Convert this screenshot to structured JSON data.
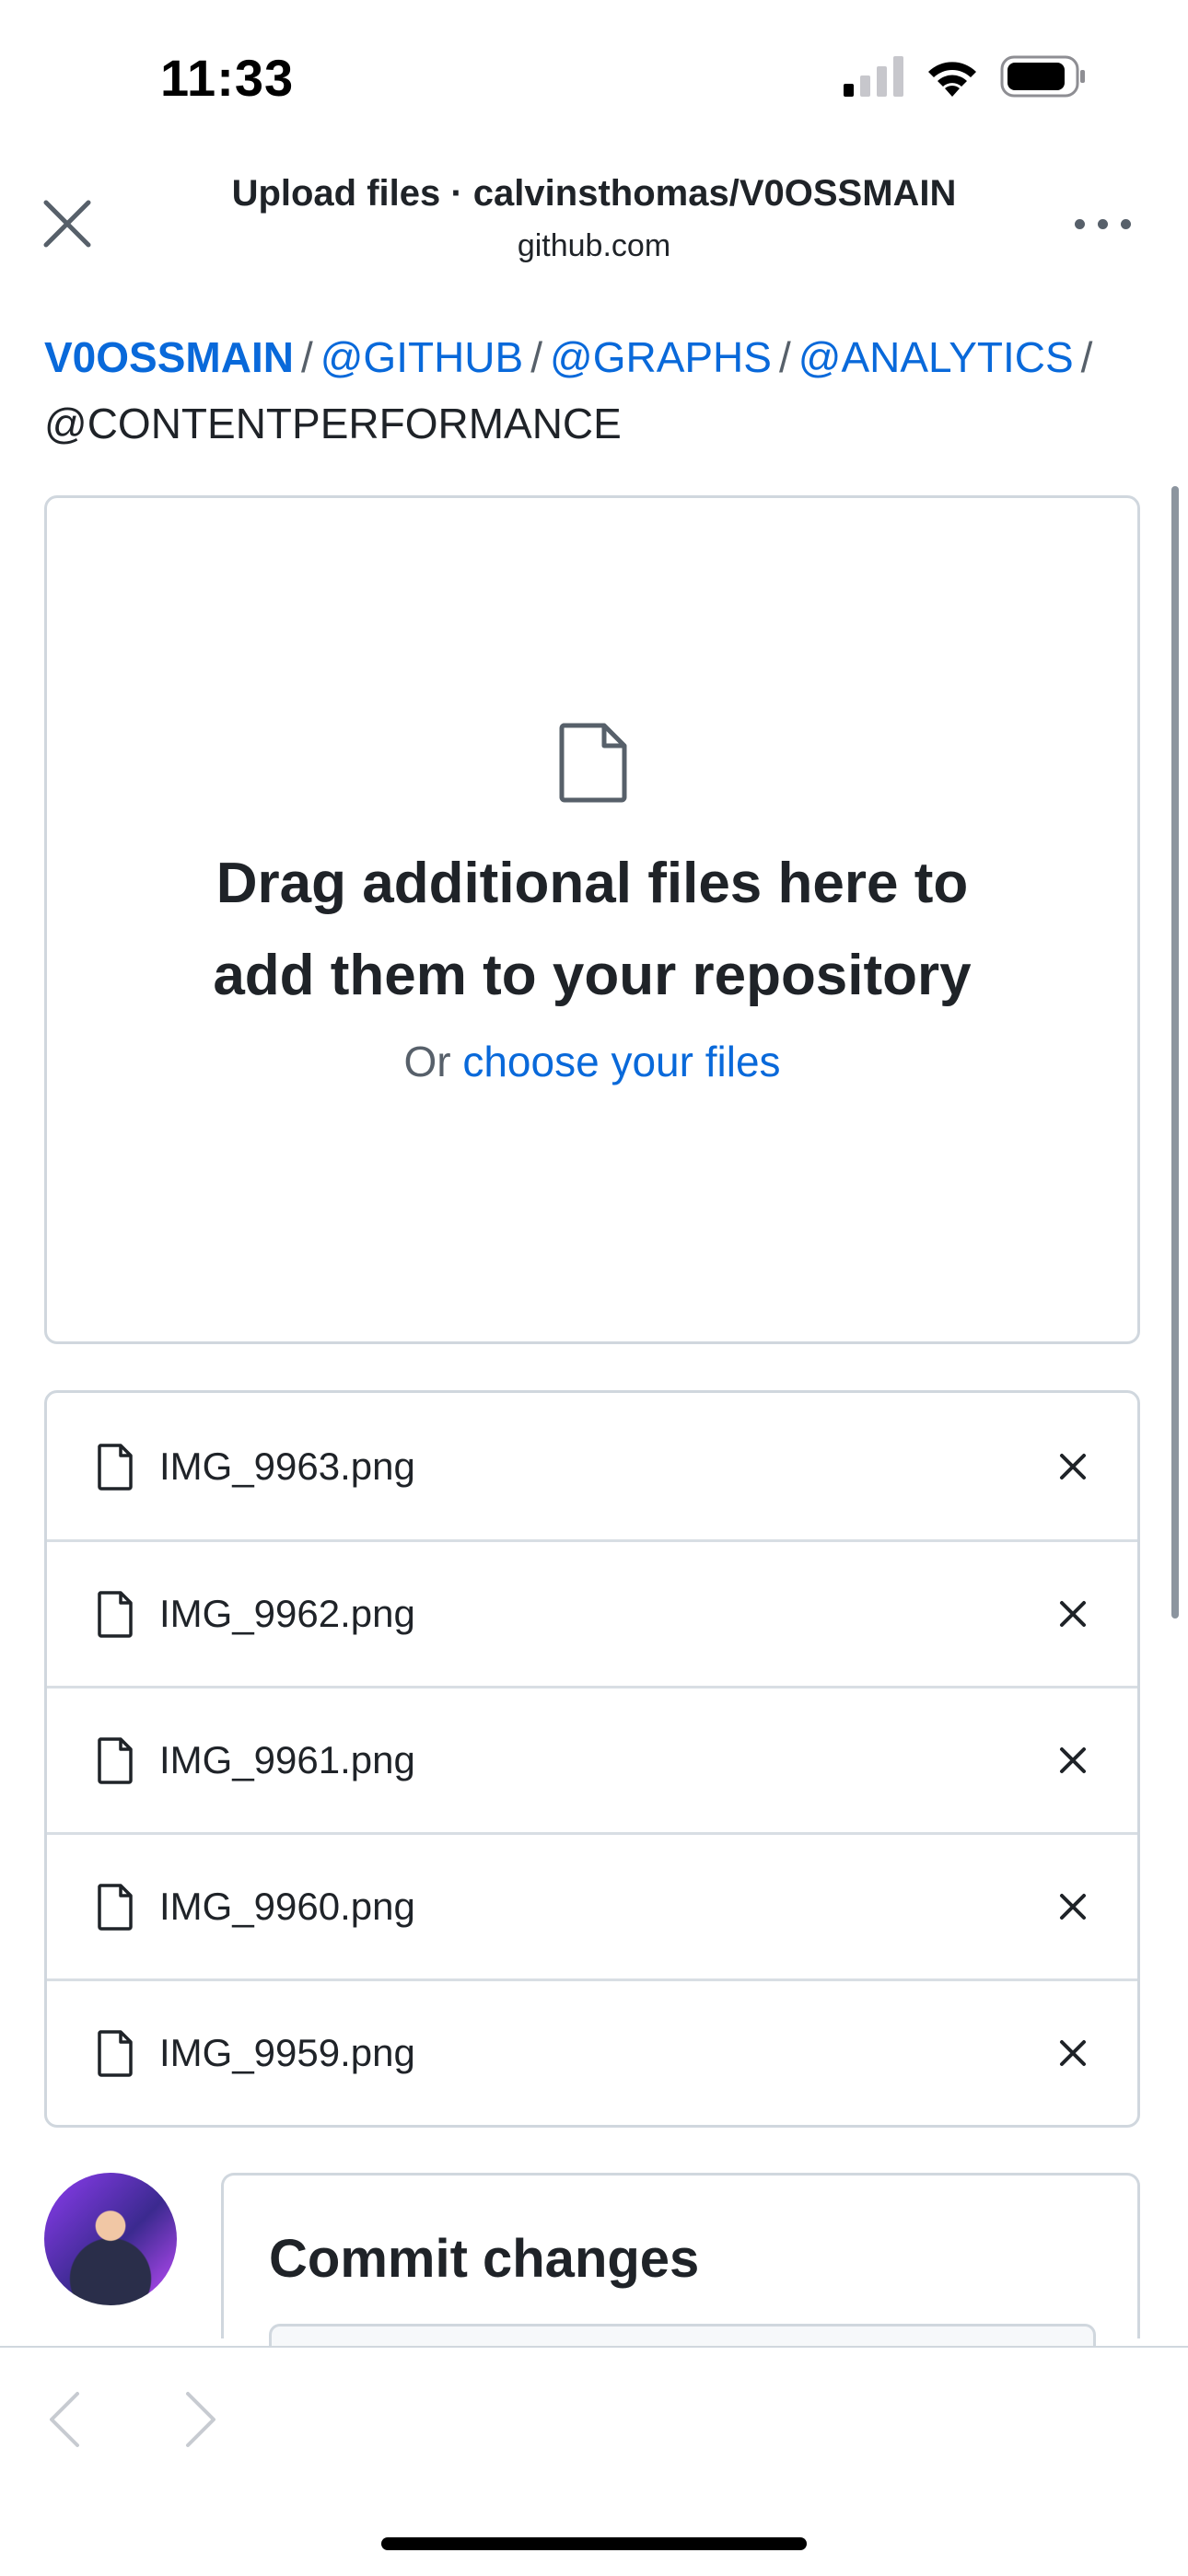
{
  "status_bar": {
    "time": "11:33",
    "icons": [
      "cellular-signal-icon",
      "wifi-icon",
      "battery-icon"
    ]
  },
  "header": {
    "title": "Upload files · calvinsthomas/V0OSSMAIN",
    "domain": "github.com",
    "close_icon": "close-icon",
    "more_icon": "more-options-icon"
  },
  "breadcrumb": {
    "root": "V0OSSMAIN",
    "items": [
      "@GITHUB",
      "@GRAPHS",
      "@ANALYTICS"
    ],
    "current": "@CONTENTPERFORMANCE",
    "separator": "/"
  },
  "dropzone": {
    "icon": "file-icon",
    "line1": "Drag additional files here to",
    "line2": "add them to your repository",
    "or_text": "Or",
    "choose_link": "choose your files"
  },
  "files": [
    {
      "name": "IMG_9963.png"
    },
    {
      "name": "IMG_9962.png"
    },
    {
      "name": "IMG_9961.png"
    },
    {
      "name": "IMG_9960.png"
    },
    {
      "name": "IMG_9959.png"
    }
  ],
  "commit": {
    "title": "Commit changes"
  },
  "toolbar": {
    "back_icon": "chevron-left-icon",
    "forward_icon": "chevron-right-icon"
  },
  "colors": {
    "link": "#0969da",
    "text": "#1f2328",
    "muted": "#57606a",
    "border": "#d0d7de"
  }
}
